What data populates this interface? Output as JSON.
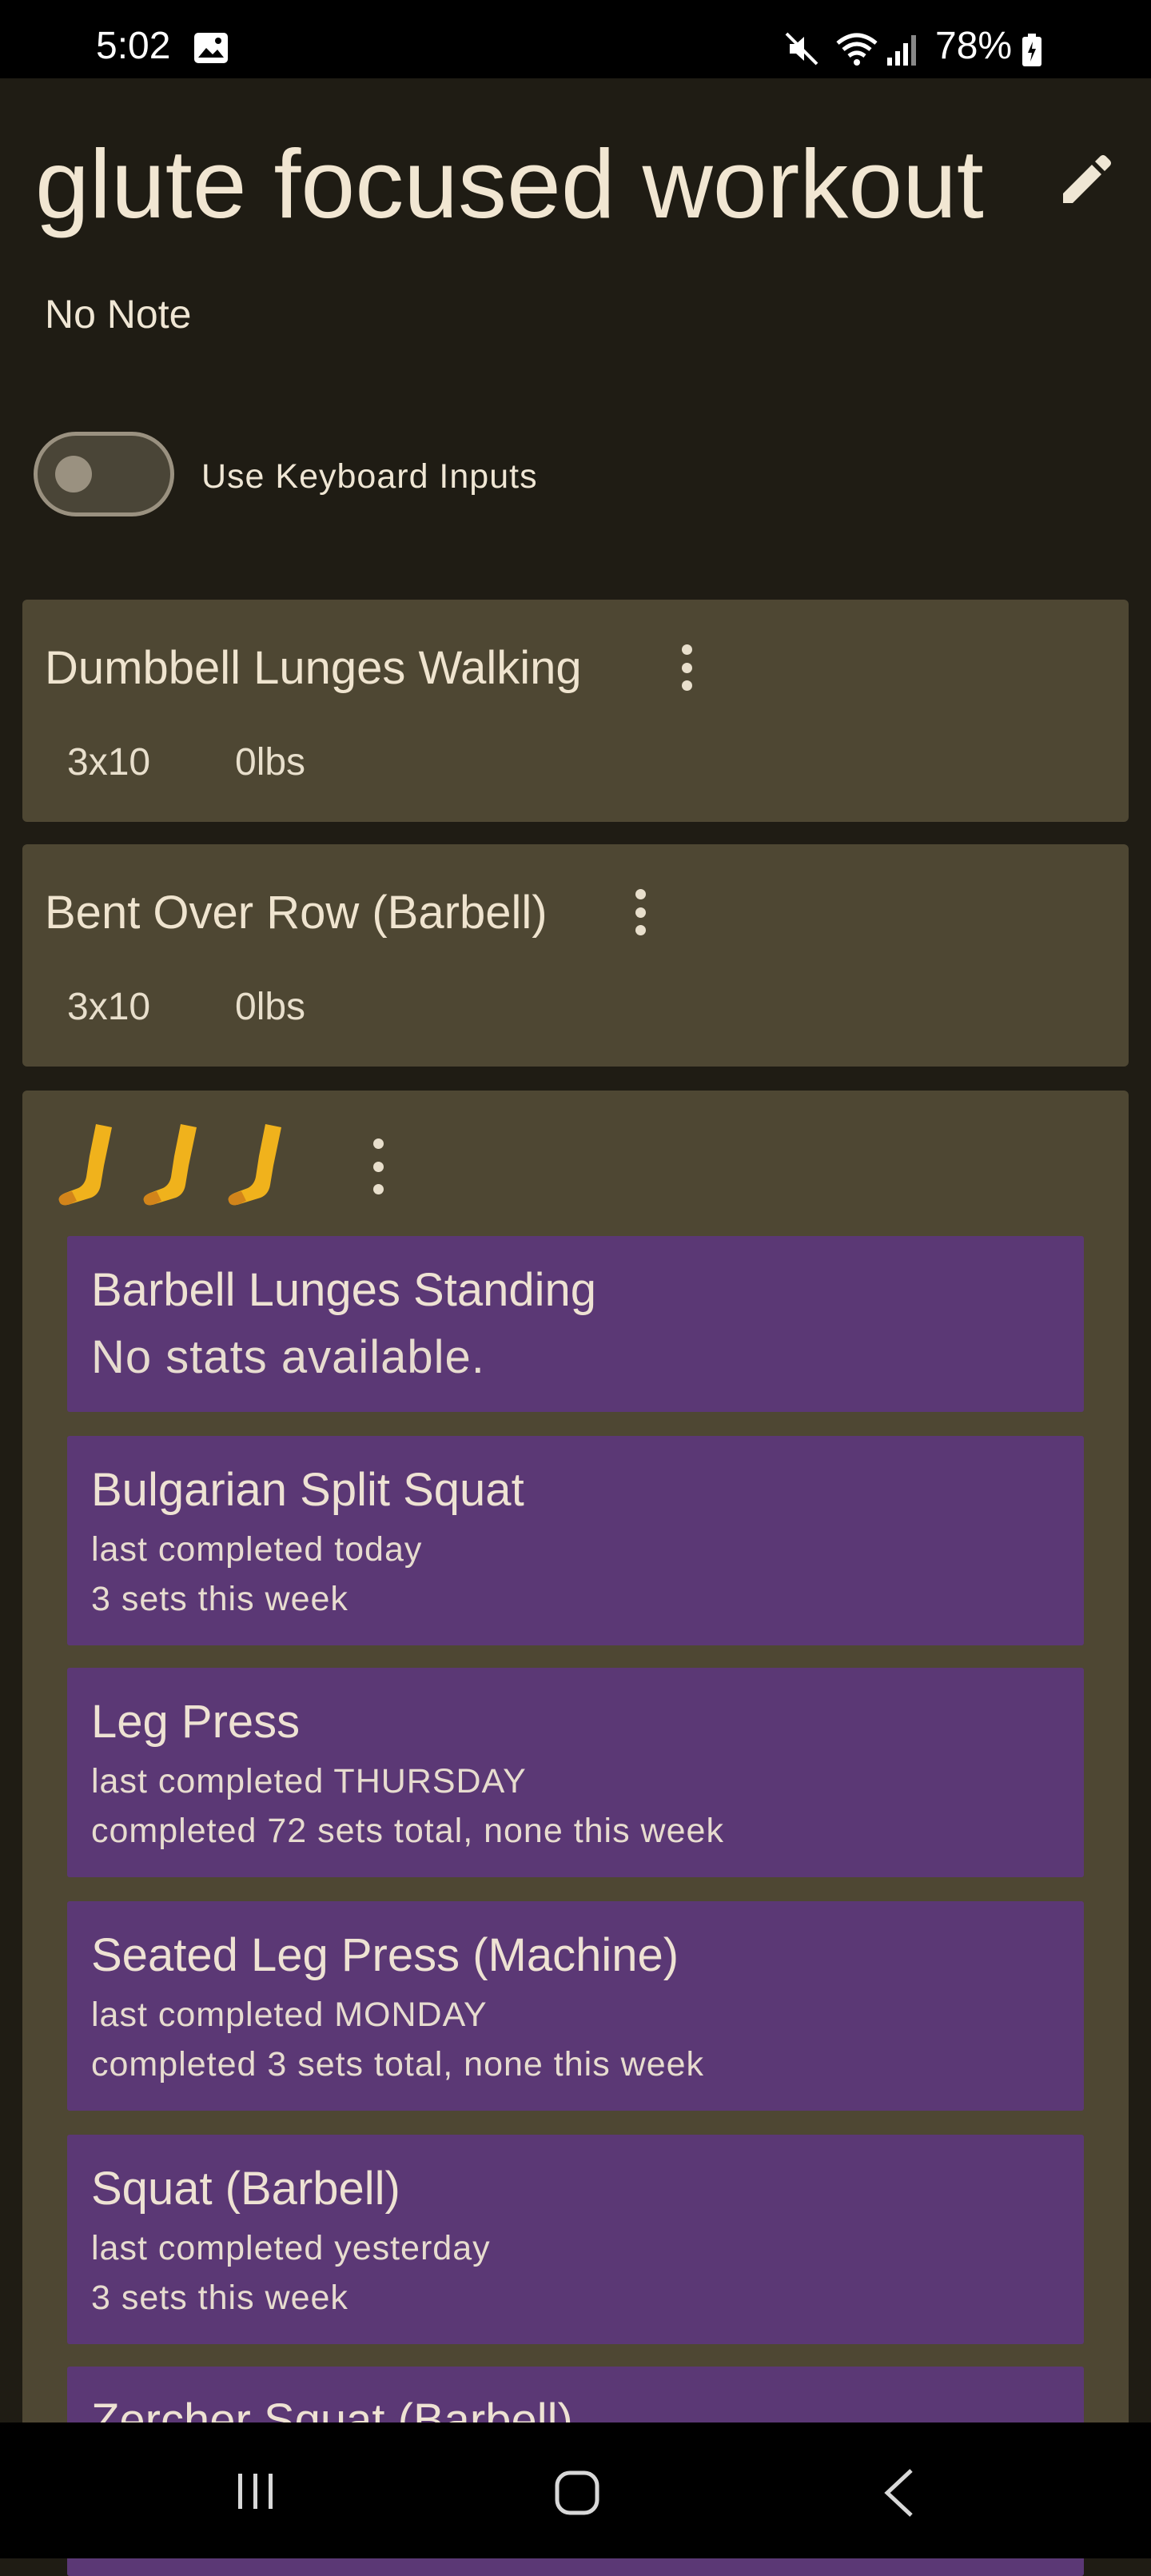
{
  "status_bar": {
    "time": "5:02",
    "battery": "78%",
    "icons": [
      "gallery-icon",
      "mute-icon",
      "wifi-icon",
      "signal-icon",
      "battery-icon"
    ]
  },
  "header": {
    "title": "glute focused workout",
    "note": "No Note"
  },
  "keyboard_toggle": {
    "label": "Use Keyboard Inputs",
    "on": false
  },
  "exercises": [
    {
      "name": "Dumbbell Lunges Walking",
      "reps": "3x10",
      "weight": "0lbs"
    },
    {
      "name": "Bent Over Row (Barbell)",
      "reps": "3x10",
      "weight": "0lbs"
    }
  ],
  "group": {
    "icon": "leg-icon",
    "icon_count": 3,
    "suggestions": [
      {
        "name": "Barbell Lunges Standing",
        "line1": "No stats available.",
        "line2": ""
      },
      {
        "name": "Bulgarian Split Squat",
        "line1": "last completed today",
        "line2": "3 sets this week"
      },
      {
        "name": "Leg Press",
        "line1": "last completed THURSDAY",
        "line2": "completed 72 sets total, none this week"
      },
      {
        "name": "Seated Leg Press (Machine)",
        "line1": "last completed MONDAY",
        "line2": "completed 3 sets total, none this week"
      },
      {
        "name": "Squat (Barbell)",
        "line1": "last completed yesterday",
        "line2": "3 sets this week"
      },
      {
        "name": "Zercher Squat (Barbell)",
        "line1": "",
        "line2": ""
      }
    ]
  },
  "colors": {
    "background": "#1f1c14",
    "card": "#4e4733",
    "suggestion": "#5b3875",
    "text": "#efe6d4"
  }
}
